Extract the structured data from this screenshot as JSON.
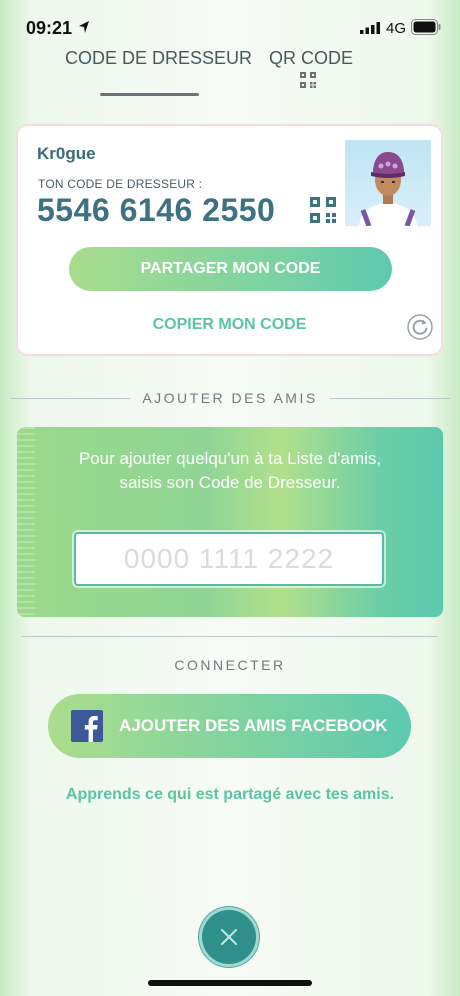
{
  "status_bar": {
    "time": "09:21",
    "network": "4G"
  },
  "tabs": [
    {
      "label": "CODE DE DRESSEUR",
      "active": true
    },
    {
      "label": "QR CODE",
      "active": false
    }
  ],
  "card": {
    "trainer_name": "Kr0gue",
    "code_label": "TON CODE DE DRESSEUR :",
    "code_value": "5546 6146 2550",
    "share_label": "PARTAGER MON CODE",
    "copy_label": "COPIER MON CODE"
  },
  "add_friends": {
    "title": "AJOUTER DES AMIS",
    "instructions": "Pour ajouter quelqu'un à ta Liste d'amis, saisis son Code de Dresseur.",
    "input_value": "",
    "input_placeholder": "0000 1111 2222"
  },
  "connect": {
    "title": "CONNECTER",
    "facebook_label": "AJOUTER DES AMIS FACEBOOK",
    "learn_label": "Apprends ce qui est partagé avec tes amis."
  },
  "colors": {
    "accent_green": "#5cc4a6",
    "code_blue": "#3d7283",
    "close_button": "#2f8f8b"
  },
  "icons": [
    "location-arrow-icon",
    "signal-icon",
    "battery-icon",
    "qr-code-icon",
    "refresh-icon",
    "facebook-icon",
    "close-icon"
  ]
}
